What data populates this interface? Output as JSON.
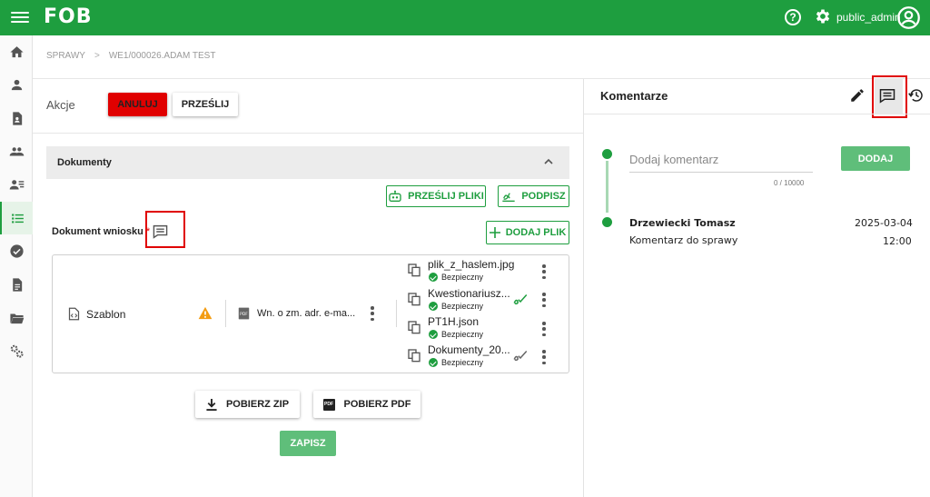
{
  "header": {
    "logo": "FOB",
    "menu_icon": "hamburger-icon",
    "help_icon": "help-icon",
    "settings_icon": "gear-icon",
    "user_name": "public_admin",
    "avatar_icon": "account-circle-icon",
    "brand_color": "#1e9e3f"
  },
  "sidebar": {
    "items": [
      {
        "icon": "home-icon"
      },
      {
        "icon": "person-icon"
      },
      {
        "icon": "document-account-icon"
      },
      {
        "icon": "people-icon"
      },
      {
        "icon": "person-list-icon"
      },
      {
        "icon": "list-icon",
        "active": true
      },
      {
        "icon": "check-circle-icon"
      },
      {
        "icon": "file-text-icon"
      },
      {
        "icon": "folder-icon"
      },
      {
        "icon": "settings-cogs-icon"
      }
    ]
  },
  "breadcrumb": {
    "root": "SPRAWY",
    "separator": ">",
    "current": "WE1/000026.ADAM TEST"
  },
  "actions": {
    "label": "Akcje",
    "cancel": "ANULUJ",
    "send": "PRZEŚLIJ"
  },
  "documents": {
    "section_title": "Dokumenty",
    "send_files": "PRZEŚLIJ PLIKI",
    "sign": "PODPISZ",
    "field_label": "Dokument wniosku",
    "required_mark": "*",
    "add_file": "DODAJ PLIK",
    "template_label": "Szablon",
    "generated_doc": "Wn. o zm. adr. e-ma...",
    "files": [
      {
        "name": "plik_z_haslem.jpg",
        "status": "Bezpieczny",
        "signed": false
      },
      {
        "name": "Kwestionariusz...",
        "status": "Bezpieczny",
        "signed": true
      },
      {
        "name": "PT1H.json",
        "status": "Bezpieczny",
        "signed": false
      },
      {
        "name": "Dokumenty_20...",
        "status": "Bezpieczny",
        "signed": true
      }
    ],
    "download_zip": "POBIERZ ZIP",
    "download_pdf": "POBIERZ PDF",
    "pdf_badge": "PDF",
    "save": "ZAPISZ"
  },
  "comments": {
    "title": "Komentarze",
    "input_placeholder": "Dodaj komentarz",
    "counter": "0 / 10000",
    "add_button": "DODAJ",
    "items": [
      {
        "author": "Drzewiecki Tomasz",
        "text": "Komentarz do sprawy",
        "date": "2025-03-04",
        "time": "12:00"
      }
    ]
  }
}
